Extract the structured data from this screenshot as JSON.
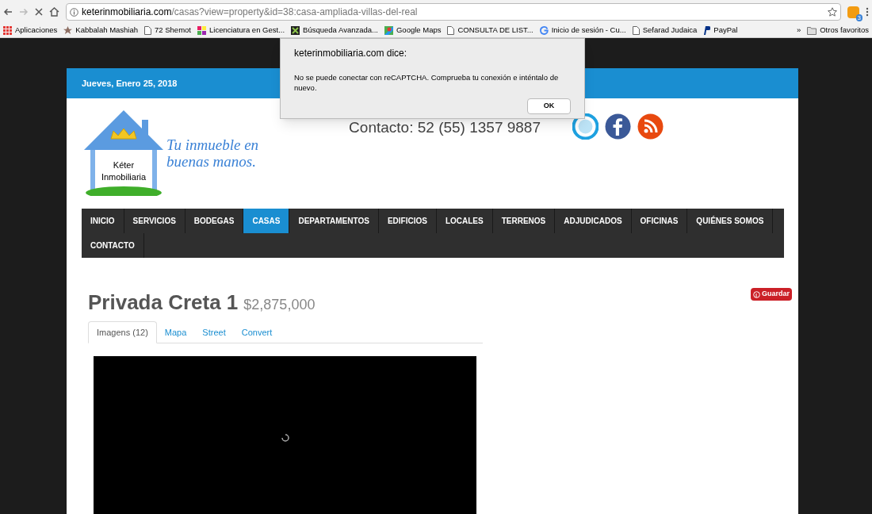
{
  "browser": {
    "url_host": "keterinmobiliaria.com",
    "url_path": "/casas?view=property&id=38:casa-ampliada-villas-del-real",
    "extension_badge": "3",
    "bookmarks": [
      {
        "label": "Aplicaciones",
        "kind": "apps"
      },
      {
        "label": "Kabbalah Mashiah",
        "kind": "star"
      },
      {
        "label": "72 Shemot",
        "kind": "page"
      },
      {
        "label": "Licenciatura en Gest...",
        "kind": "color"
      },
      {
        "label": "Búsqueda Avanzada...",
        "kind": "dark"
      },
      {
        "label": "Google Maps",
        "kind": "map"
      },
      {
        "label": "CONSULTA DE LIST...",
        "kind": "page"
      },
      {
        "label": "Inicio de sesión - Cu...",
        "kind": "google"
      },
      {
        "label": "Sefarad Judaica",
        "kind": "page"
      },
      {
        "label": "PayPal",
        "kind": "paypal"
      }
    ],
    "overflow": "»",
    "other_bookmarks": "Otros favoritos"
  },
  "site": {
    "date": "Jueves, Enero 25, 2018",
    "logo_line1": "Kéter",
    "logo_line2": "Inmobiliaria",
    "slogan_line1": "Tu inmueble en",
    "slogan_line2": "buenas manos.",
    "contact": "Contacto: 52 (55) 1357 9887",
    "nav": [
      {
        "label": "INICIO",
        "selected": false
      },
      {
        "label": "SERVICIOS",
        "selected": false
      },
      {
        "label": "BODEGAS",
        "selected": false
      },
      {
        "label": "CASAS",
        "selected": true
      },
      {
        "label": "DEPARTAMENTOS",
        "selected": false
      },
      {
        "label": "EDIFICIOS",
        "selected": false
      },
      {
        "label": "LOCALES",
        "selected": false
      },
      {
        "label": "TERRENOS",
        "selected": false
      },
      {
        "label": "ADJUDICADOS",
        "selected": false
      },
      {
        "label": "OFICINAS",
        "selected": false
      },
      {
        "label": "QUIÉNES SOMOS",
        "selected": false
      },
      {
        "label": "CONTACTO",
        "selected": false
      }
    ],
    "title": "Privada Creta 1",
    "price": "$2,875,000",
    "pin_button": "Guardar",
    "tabs": [
      {
        "label": "Imagens (12)",
        "selected": true
      },
      {
        "label": "Mapa",
        "selected": false
      },
      {
        "label": "Street",
        "selected": false
      },
      {
        "label": "Convert",
        "selected": false
      }
    ]
  },
  "dialog": {
    "title": "keterinmobiliaria.com dice:",
    "message": "No se puede conectar con reCAPTCHA. Comprueba tu conexión e inténtalo de nuevo.",
    "button": "OK"
  }
}
